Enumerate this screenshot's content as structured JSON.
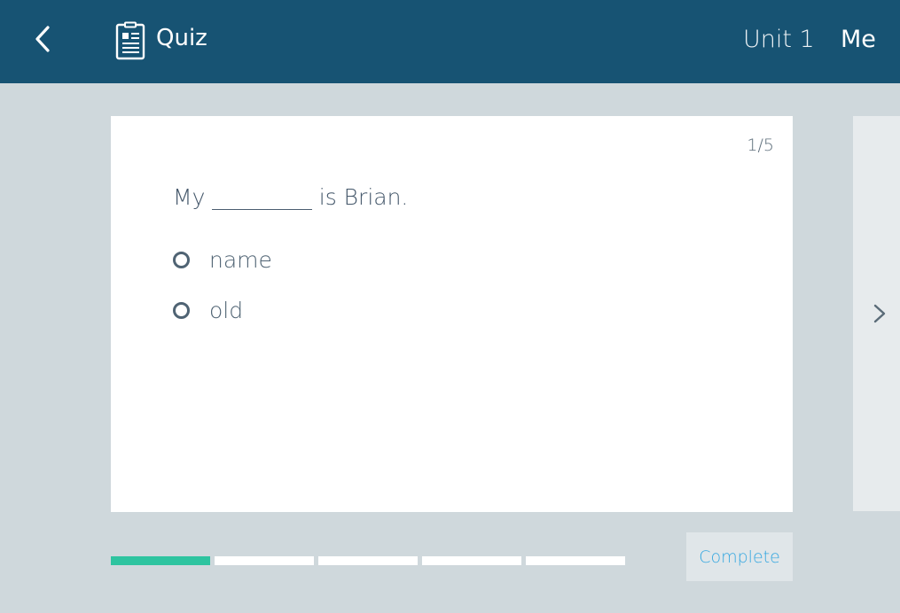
{
  "header": {
    "title": "Quiz",
    "unit": "Unit 1",
    "user": "Me",
    "background_color": "#175373"
  },
  "card": {
    "counter": "1/5",
    "question": "My _________ is Brian.",
    "options": [
      {
        "label": "name"
      },
      {
        "label": "old"
      }
    ]
  },
  "progress": {
    "current": 1,
    "total": 5,
    "active_color": "#2ec4a0"
  },
  "footer": {
    "complete_label": "Complete",
    "complete_color": "#35a7e0"
  }
}
